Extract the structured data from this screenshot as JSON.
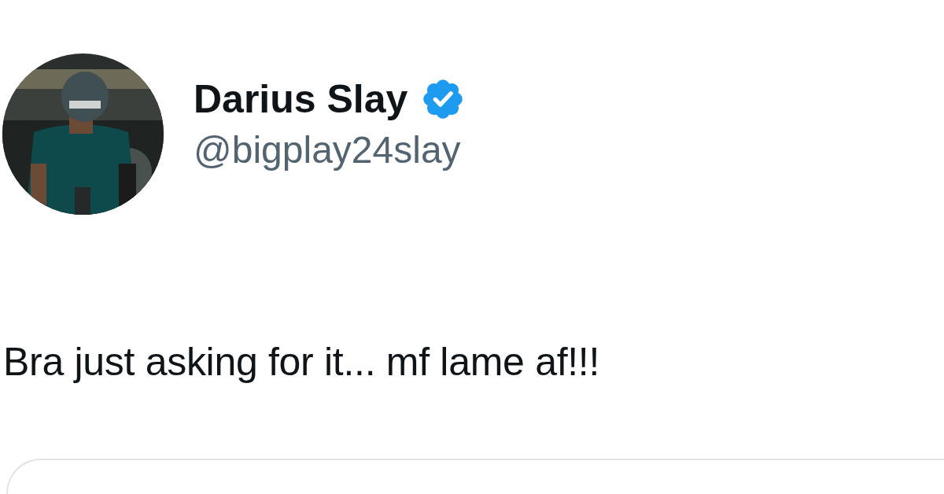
{
  "author": {
    "name": "Darius Slay",
    "verified": true,
    "handle": "@bigplay24slay"
  },
  "tweet": {
    "text": "Bra just asking for it... mf lame af!!!"
  },
  "card": {
    "kind": "embed"
  }
}
